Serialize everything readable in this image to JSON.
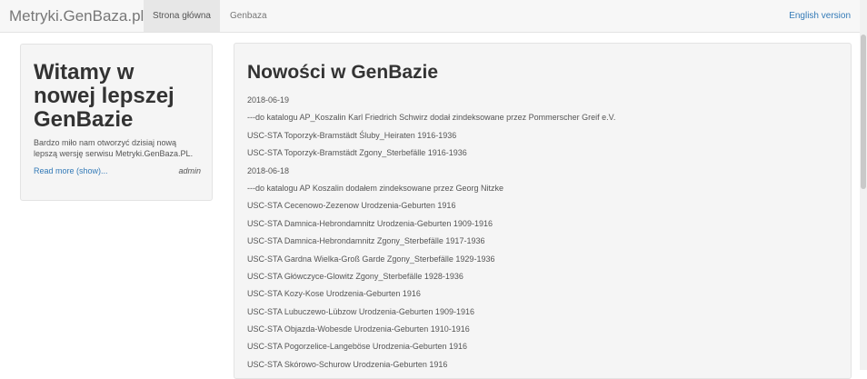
{
  "navbar": {
    "brand": "Metryki.GenBaza.pl",
    "tabs": [
      {
        "label": "Strona główna",
        "active": true
      },
      {
        "label": "Genbaza",
        "active": false
      }
    ],
    "language_link": "English version"
  },
  "welcome": {
    "title": "Witamy w nowej lepszej GenBazie",
    "body": "Bardzo miło nam otworzyć dzisiaj nową lepszą wersję serwisu Metryki.GenBaza.PL.",
    "read_more": "Read more (show)...",
    "author": "admin"
  },
  "news": {
    "title": "Nowości w GenBazie",
    "items": [
      "2018-06-19",
      "---do katalogu AP_Koszalin Karl Friedrich Schwirz dodał zindeksowane przez Pommerscher Greif e.V.",
      "USC-STA Toporzyk-Bramstädt Śluby_Heiraten 1916-1936",
      "USC-STA Toporzyk-Bramstädt Zgony_Sterbefälle 1916-1936",
      "2018-06-18",
      "---do katalogu AP Koszalin dodałem zindeksowane przez Georg Nitzke",
      "USC-STA Cecenowo-Zezenow Urodzenia-Geburten 1916",
      "USC-STA Damnica-Hebrondamnitz Urodzenia-Geburten 1909-1916",
      "USC-STA Damnica-Hebrondamnitz Zgony_Sterbefälle 1917-1936",
      "USC-STA Gardna Wielka-Groß Garde Zgony_Sterbefälle 1929-1936",
      "USC-STA Główczyce-Glowitz Zgony_Sterbefälle 1928-1936",
      "USC-STA Kozy-Kose Urodzenia-Geburten 1916",
      "USC-STA Lubuczewo-Lübzow Urodzenia-Geburten 1909-1916",
      "USC-STA Objazda-Wobesde Urodzenia-Geburten 1910-1916",
      "USC-STA Pogorzelice-Langeböse Urodzenia-Geburten 1916",
      "USC-STA Skórowo-Schurow Urodzenia-Geburten 1916"
    ]
  }
}
